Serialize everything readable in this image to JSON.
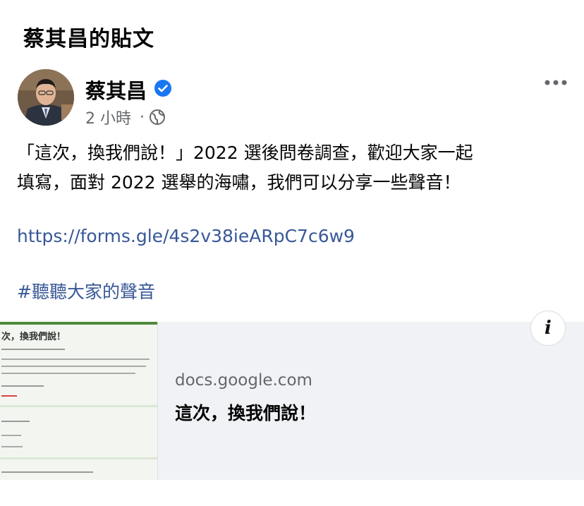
{
  "header": {
    "title": "蔡其昌的貼文"
  },
  "post": {
    "author": "蔡其昌",
    "time": "2 小時",
    "separator": "·",
    "body_line1": "「這次，換我們說！」2022 選後問卷調查，歡迎大家一起",
    "body_line2": "填寫，面對 2022 選舉的海嘯，我們可以分享一些聲音！",
    "link": "https://forms.gle/4s2v38ieARpC7c6w9",
    "hashtag": "#聽聽大家的聲音"
  },
  "link_card": {
    "thumbnail_title": "次，換我們說！",
    "domain": "docs.google.com",
    "title": "這次，換我們說！",
    "info_label": "i"
  },
  "icons": {
    "verified": "verified-badge-icon",
    "more": "more-horizontal-icon",
    "globe": "globe-icon",
    "info": "info-icon"
  },
  "colors": {
    "link": "#385898",
    "verified": "#1877f2",
    "meta_text": "#65676b",
    "card_background": "#f0f2f5"
  }
}
